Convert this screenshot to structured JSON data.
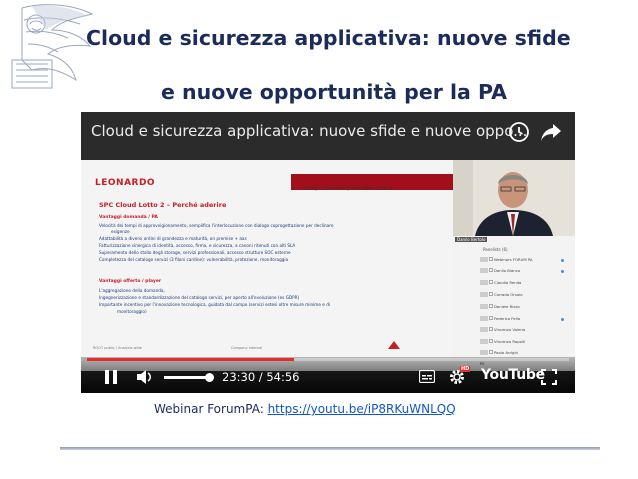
{
  "slide": {
    "title_line1": "Cloud e sicurezza applicativa: nuove sfide",
    "title_line2": "e nuove opportunità per la PA"
  },
  "video": {
    "title": "Cloud e sicurezza applicativa: nuove sfide e nuove oppo...",
    "current_time": "23:30",
    "duration": "54:56",
    "time_separator": " / ",
    "progress_fraction": 0.43,
    "platform": "YouTube",
    "hd_label": "HD",
    "embedded_slide": {
      "brand": "LEONARDO",
      "crumb": "Consip - Contratto Quadro SPC - Lotto 2",
      "heading": "SPC Cloud Lotto 2 – Perché aderire",
      "section1": "Vantaggi domanda / PA",
      "lines1": [
        "Velocità dei tempi di approvvigionamento, semplifica l'interlocuzione con dialogo coprogettazione per declinare",
        "esigenze",
        "Adattabilità a diversi ordini di grandezza e maturità, on premise + aas",
        "Fatturizzazione sinergica di identità, accesso, firma, e sicurezza, a canoni ritenuti con alti SLA",
        "Superamento dello stallo degli storage, servizi professionali, accesso strutture SOC esterne",
        "Completezza del catalogo servizi (3 filoni cardine): vulnerabilità, protezione, monitoraggio"
      ],
      "section2": "Vantaggi offerto / player",
      "lines2": [
        "L'aggregazione della domanda,",
        "Ingegnerizzazione e standardizzazione del catalogo servizi, per aperto all'evoluzione (es GDPR)",
        "Importante incentivo per l'innovazione tecnologica, guidata dal campo (servizi estesi oltre misure minime e di",
        "monitoraggio)"
      ],
      "footer_left": "ROOT public / Analysis wide",
      "footer_mid": "Company Internal"
    },
    "participants_header": "Panelists (6)",
    "presenter_label": "Danilo Bertolo",
    "participants": [
      {
        "badge": "MO",
        "name": "Webinars FORUM PA"
      },
      {
        "badge": "DB",
        "name": "Danilo Bianco"
      },
      {
        "badge": "CR",
        "name": "Claudio Renda"
      },
      {
        "badge": "CO",
        "name": "Corrado Orsolo"
      },
      {
        "badge": "DR",
        "name": "Daniele Rizzo"
      },
      {
        "badge": "FA",
        "name": "Federica Fella"
      },
      {
        "badge": "VS",
        "name": "Vincenzo Valeria"
      },
      {
        "badge": "VR",
        "name": "Vincenzo Rapolli"
      },
      {
        "badge": "PS",
        "name": "Paolo Arrighi"
      }
    ]
  },
  "caption": {
    "prefix": "Webinar ForumPA: ",
    "link_text": "https://youtu.be/iP8RKuWNLQQ"
  },
  "colors": {
    "title": "#1c2c5a",
    "link": "#1155cc",
    "youtube_red": "#e52d27",
    "slide_red": "#c81d25"
  }
}
